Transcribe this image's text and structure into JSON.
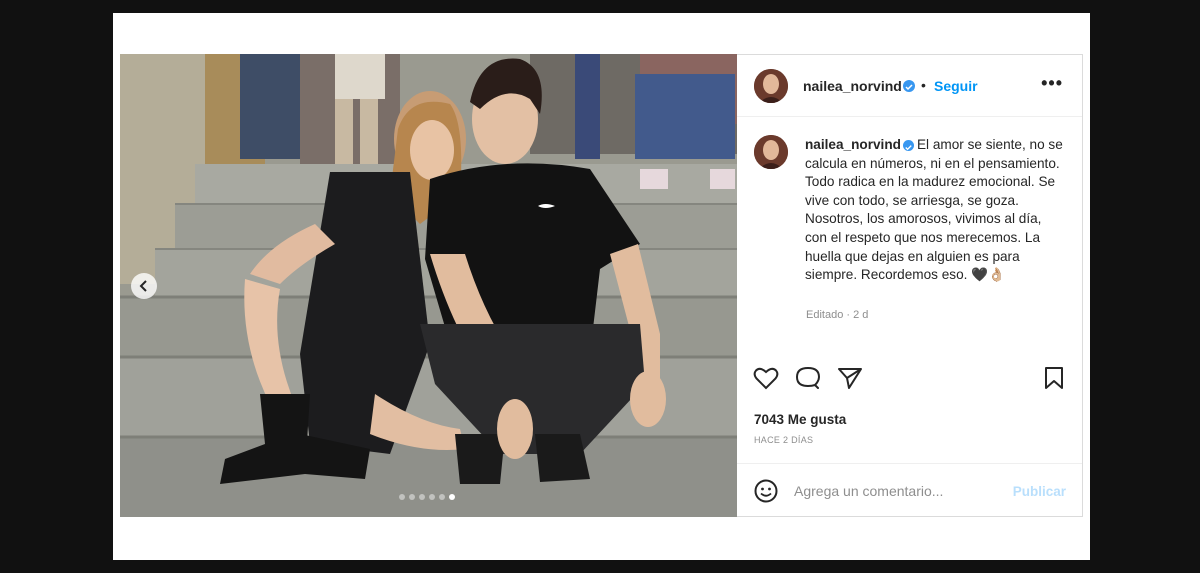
{
  "post": {
    "dots_count": 6,
    "active_dot": 5
  },
  "header": {
    "username": "nailea_norvind",
    "separator": "•",
    "follow_label": "Seguir",
    "more_label": "•••"
  },
  "caption": {
    "username": "nailea_norvind",
    "text": "El amor se siente, no se calcula en números, ni en el pensamiento. Todo radica en la madurez emocional. Se vive con todo, se arriesga, se goza. Nosotros, los amorosos, vivimos al día, con el respeto que nos merecemos. La huella que dejas en alguien es para siempre. Recordemos eso. 🖤👌🏼",
    "edited": "Editado · 2 d"
  },
  "stats": {
    "likes": "7043 Me gusta",
    "time": "HACE 2 DÍAS"
  },
  "comment": {
    "placeholder": "Agrega un comentario...",
    "publish_label": "Publicar"
  },
  "colors": {
    "accent": "#0095f6",
    "verified": "#3897f0",
    "publish_disabled": "#b9dffc",
    "text": "#262626",
    "muted": "#8e8e8e"
  },
  "icons": [
    "chevron-left-icon",
    "verified-icon",
    "more-icon",
    "heart-icon",
    "comment-icon",
    "share-icon",
    "bookmark-icon",
    "emoji-icon"
  ]
}
